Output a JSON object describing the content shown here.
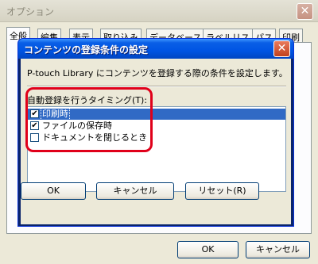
{
  "outer_window": {
    "title": "オプション",
    "close_label": "✕",
    "tabs": [
      "全般",
      "編集",
      "表示",
      "取り込み",
      "データベース",
      "ラベルリスト",
      "パス",
      "印刷"
    ],
    "ok_label": "OK",
    "cancel_label": "キャンセル"
  },
  "dialog": {
    "title": "コンテンツの登録条件の設定",
    "close_label": "✕",
    "description": "P-touch Library にコンテンツを登録する際の条件を設定します。",
    "timing_label": "自動登録を行うタイミング(T):",
    "options": [
      {
        "label": "印刷時",
        "checked": "✔",
        "selected": true
      },
      {
        "label": "ファイルの保存時",
        "checked": "✔",
        "selected": false
      },
      {
        "label": "ドキュメントを閉じるとき",
        "checked": "",
        "selected": false
      }
    ],
    "ok_label": "OK",
    "cancel_label": "キャンセル",
    "reset_label": "リセット(R)"
  },
  "colors": {
    "highlight": "#e0001a",
    "selection": "#316ac5",
    "titlebar": "#0054e3"
  }
}
